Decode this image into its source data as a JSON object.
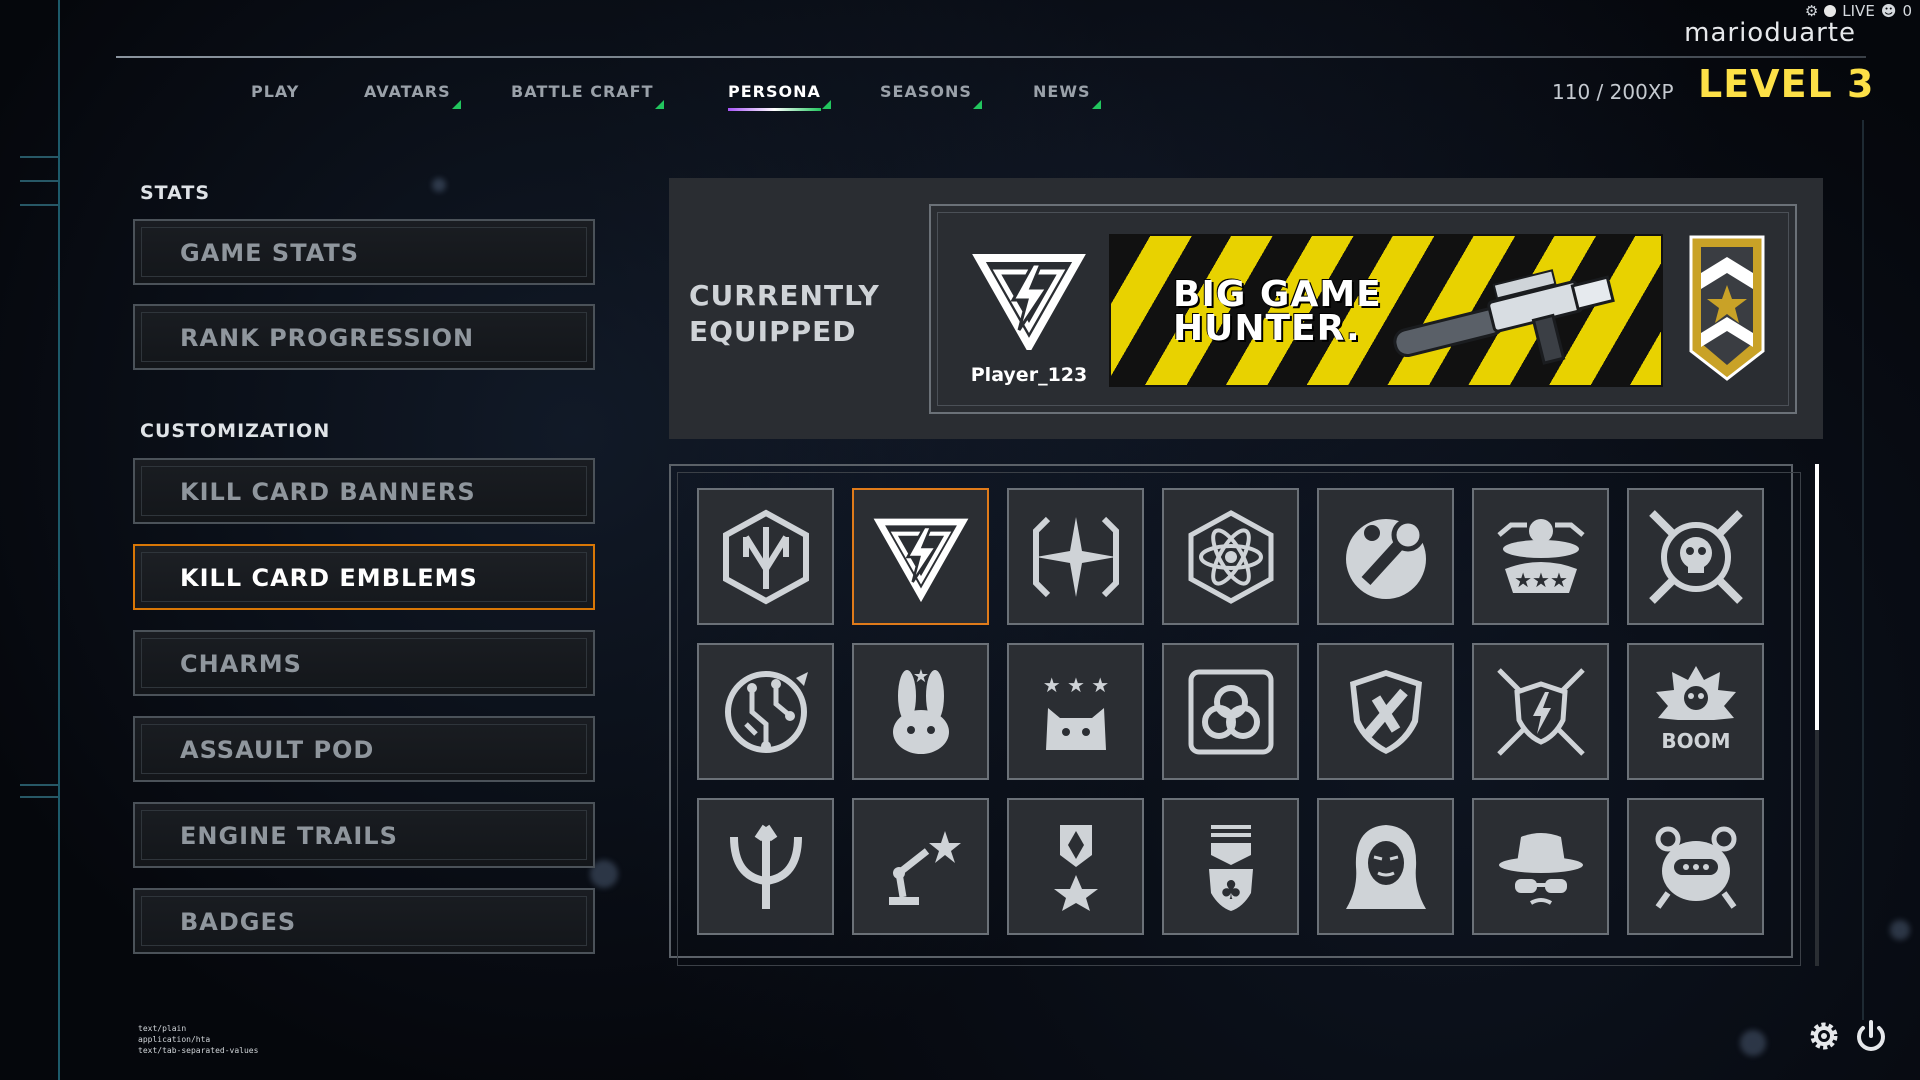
{
  "status": {
    "live_label": "LIVE",
    "count": "0"
  },
  "user": {
    "name": "marioduarte"
  },
  "nav": {
    "tabs": [
      {
        "label": "PLAY",
        "new": false
      },
      {
        "label": "AVATARS",
        "new": true
      },
      {
        "label": "BATTLE CRAFT",
        "new": true
      },
      {
        "label": "PERSONA",
        "new": true,
        "active": true
      },
      {
        "label": "SEASONS",
        "new": true
      },
      {
        "label": "NEWS",
        "new": true
      }
    ]
  },
  "progress": {
    "xp_text": "110 / 200XP",
    "level_text": "LEVEL 3"
  },
  "sidebar": {
    "stats_heading": "STATS",
    "stats_items": [
      "GAME STATS",
      "RANK PROGRESSION"
    ],
    "customization_heading": "CUSTOMIZATION",
    "customization_items": [
      "KILL CARD BANNERS",
      "KILL CARD EMBLEMS",
      "CHARMS",
      "ASSAULT POD",
      "ENGINE TRAILS",
      "BADGES"
    ],
    "active_item": "KILL CARD EMBLEMS"
  },
  "equipped": {
    "title_line1": "CURRENTLY",
    "title_line2": "EQUIPPED",
    "player_name": "Player_123",
    "banner_line1": "BIG GAME",
    "banner_line2": "HUNTER.",
    "emblem_icon": "lightning-triangle-icon",
    "badge_icon": "rank-star-badge-icon"
  },
  "emblems": [
    [
      "trident-hexagon-icon",
      "lightning-triangle-icon",
      "star-burst-icon",
      "atom-icon",
      "comet-icon",
      "ufo-stars-icon",
      "astronaut-skull-icon"
    ],
    [
      "circuit-planet-icon",
      "bunny-icon",
      "cat-stars-icon",
      "biohazard-icon",
      "rocket-shield-icon",
      "lightning-shield-arrows-icon",
      "boom-skull-icon"
    ],
    [
      "trident-icon",
      "robot-arm-icon",
      "diamond-star-medal-icon",
      "club-shield-medal-icon",
      "hacker-mask-icon",
      "spy-hat-icon",
      "robot-head-icon"
    ]
  ],
  "selected_emblem": "lightning-triangle-icon",
  "boom_text": "BOOM",
  "footnote": [
    "text/plain",
    "application/hta",
    "text/tab-separated-values"
  ],
  "colors": {
    "accent": "#fde047",
    "selected": "#e07b1a",
    "new_marker": "#22c55e"
  }
}
